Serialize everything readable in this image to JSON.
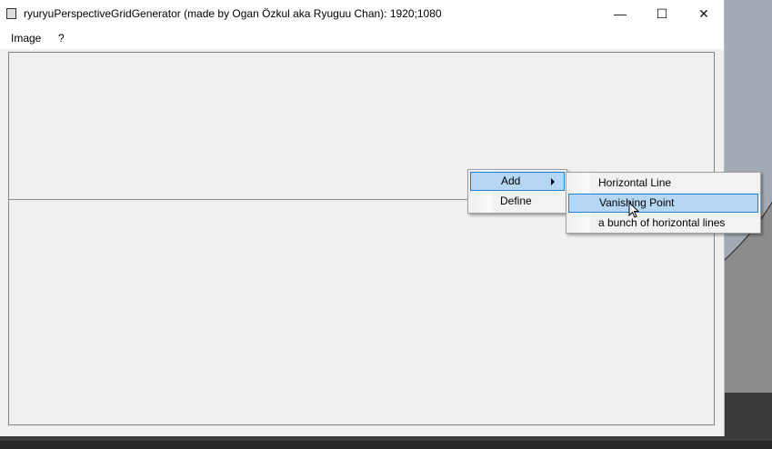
{
  "window": {
    "title": "ryuryuPerspectiveGridGenerator (made by Ogan Özkul aka Ryuguu Chan): 1920;1080",
    "minimize": "—",
    "maximize": "☐",
    "close": "✕"
  },
  "menubar": {
    "items": [
      "Image",
      "?"
    ]
  },
  "context_menu": {
    "items": [
      {
        "label": "Add",
        "highlighted": true,
        "submenu": true
      },
      {
        "label": "Define"
      }
    ]
  },
  "submenu": {
    "items": [
      {
        "label": "Horizontal Line"
      },
      {
        "label": "Vanishing Point",
        "highlighted": true
      },
      {
        "label": "a bunch of horizontal lines"
      }
    ]
  },
  "colors": {
    "highlight": "#b5d7f3",
    "highlight_border": "#1e7fd4"
  }
}
